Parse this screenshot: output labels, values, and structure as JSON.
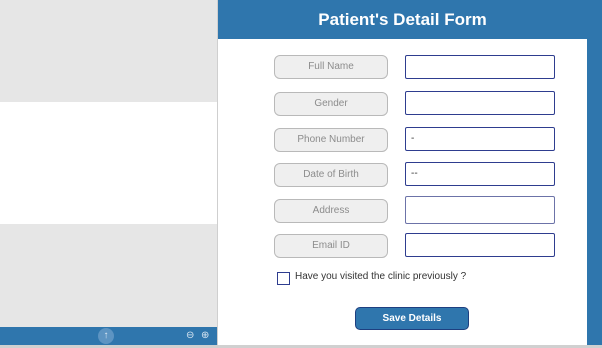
{
  "form": {
    "title": "Patient's Detail Form",
    "fields": [
      {
        "label": "Full Name",
        "value": ""
      },
      {
        "label": "Gender",
        "value": ""
      },
      {
        "label": "Phone Number",
        "value": "-"
      },
      {
        "label": "Date of Birth",
        "value": "--"
      },
      {
        "label": "Address",
        "value": ""
      },
      {
        "label": "Email ID",
        "value": ""
      }
    ],
    "visited_checkbox_label": "Have you visited the clinic previously ?",
    "visited_checked": false,
    "save_label": "Save Details"
  },
  "canvas_toolbar": {
    "fab_icon": "upload-arrow-icon",
    "zoom_out_icon": "zoom-out-icon",
    "zoom_in_icon": "zoom-in-icon"
  },
  "colors": {
    "accent": "#2f76ad",
    "field_border": "#2e3d8f"
  }
}
